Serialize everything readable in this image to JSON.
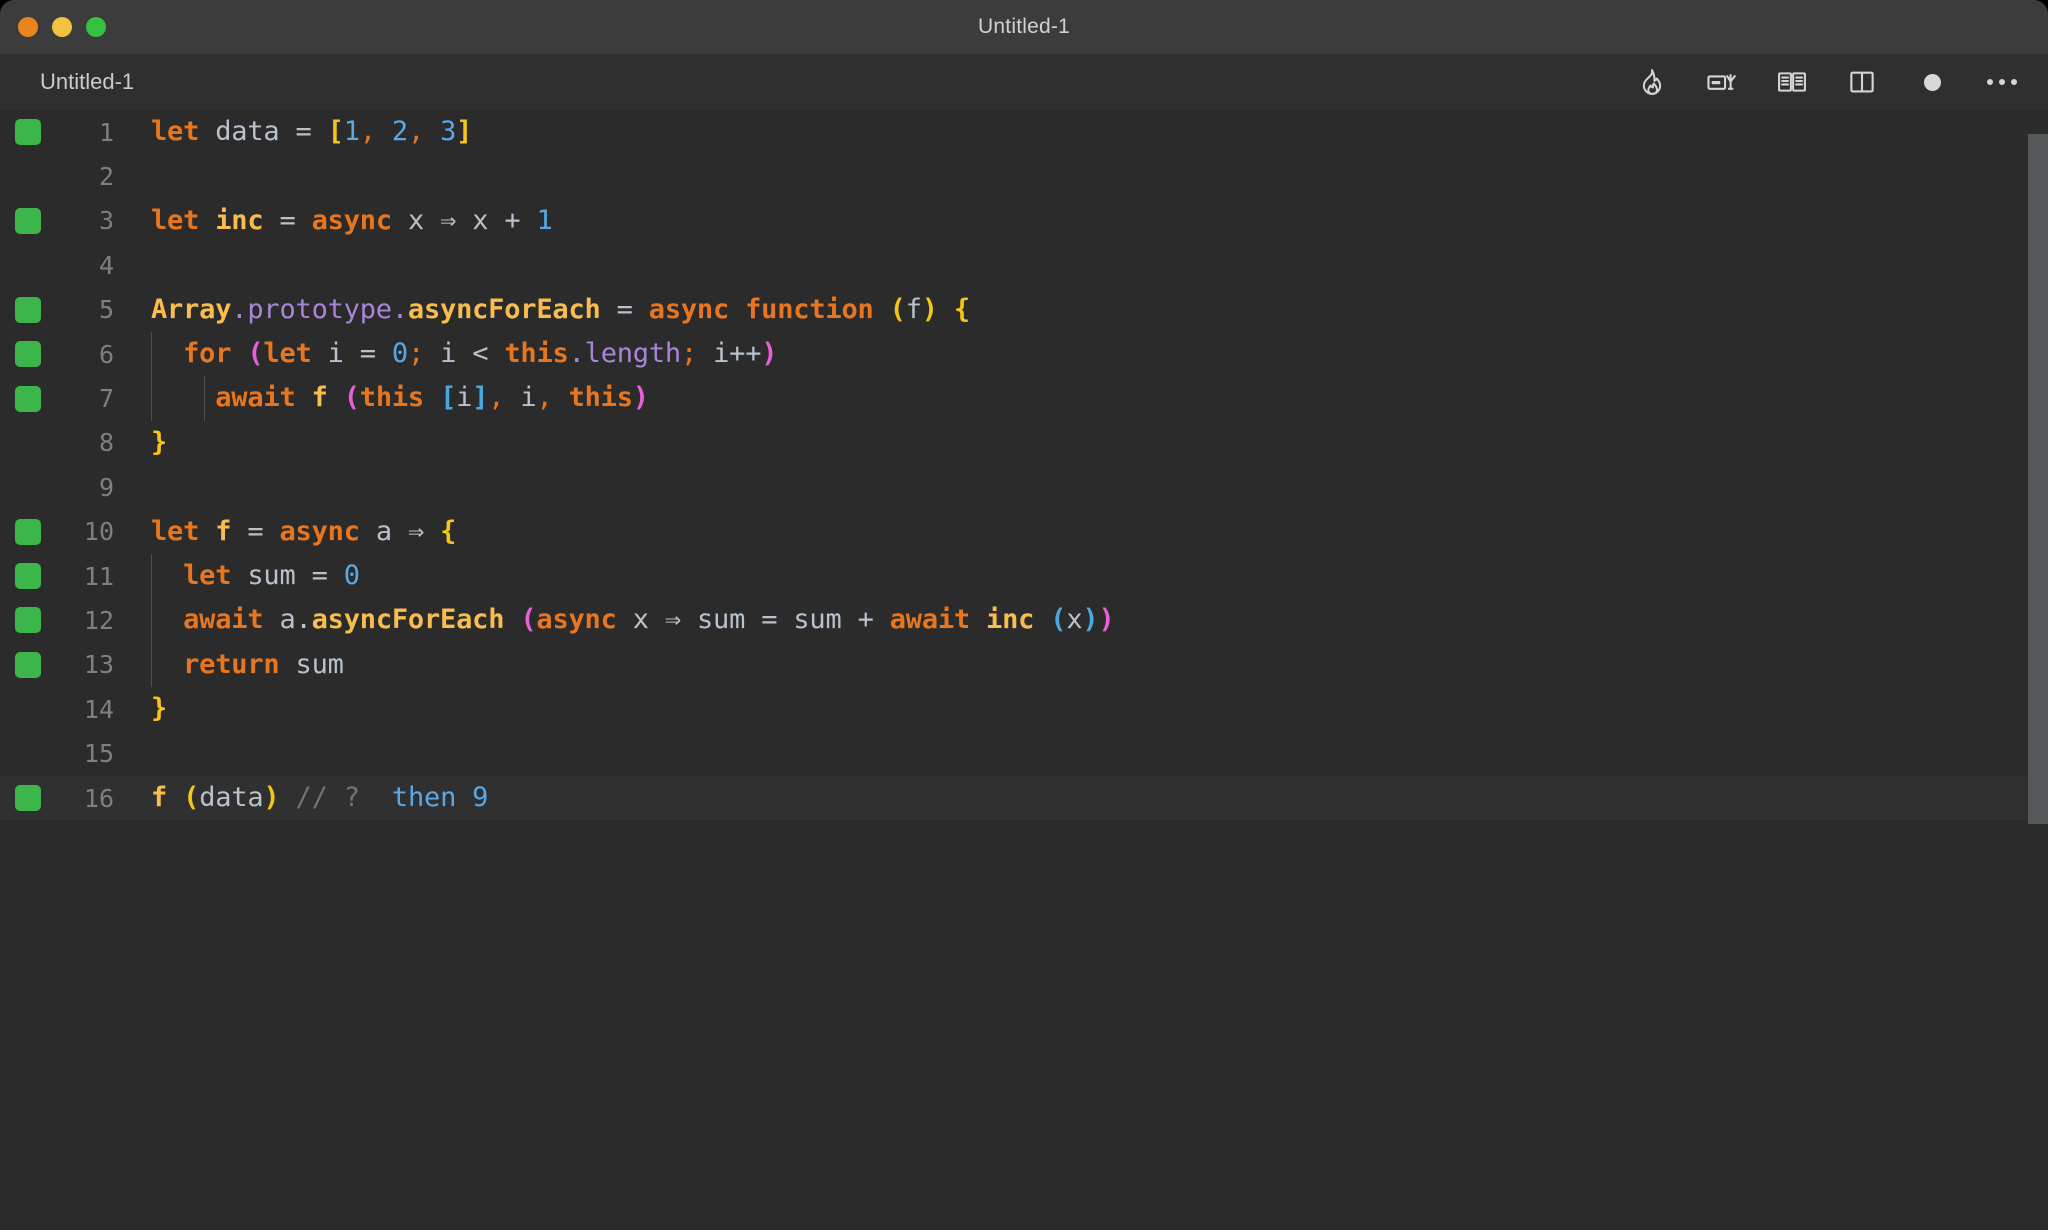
{
  "window": {
    "title": "Untitled-1",
    "traffic_lights": [
      "close",
      "minimize",
      "maximize"
    ]
  },
  "tabbar": {
    "tab_label": "Untitled-1",
    "toolbar_icons": [
      "flame-icon",
      "run-in-terminal-icon",
      "open-book-icon",
      "split-editor-icon",
      "unsaved-dot-icon",
      "more-actions-ellipsis-icon"
    ]
  },
  "colors": {
    "titlebar_bg": "#3c3c3c",
    "tabbar_bg": "#2f2f2f",
    "editor_bg": "#2b2b2b",
    "active_line_bg": "#303030",
    "breakpoint_green": "#3cb54a",
    "keyword_orange": "#e8761f",
    "function_gold": "#f9bd4e",
    "number_blue": "#5aa9e6",
    "plain_text": "#b9c2cc",
    "bracket_yellow": "#f5c518",
    "bracket_cyan": "#4aa8e0",
    "bracket_magenta": "#e861d8",
    "property_purple": "#a885d8",
    "comment_gray": "#6f7478",
    "line_number_gray": "#7c8084"
  },
  "editor": {
    "lines": [
      {
        "n": "1",
        "marker": true,
        "active": false,
        "guides": 0
      },
      {
        "n": "2",
        "marker": false,
        "active": false,
        "guides": 0
      },
      {
        "n": "3",
        "marker": true,
        "active": false,
        "guides": 0
      },
      {
        "n": "4",
        "marker": false,
        "active": false,
        "guides": 0
      },
      {
        "n": "5",
        "marker": true,
        "active": false,
        "guides": 0
      },
      {
        "n": "6",
        "marker": true,
        "active": false,
        "guides": 1
      },
      {
        "n": "7",
        "marker": true,
        "active": false,
        "guides": 2
      },
      {
        "n": "8",
        "marker": false,
        "active": false,
        "guides": 0
      },
      {
        "n": "9",
        "marker": false,
        "active": false,
        "guides": 0
      },
      {
        "n": "10",
        "marker": true,
        "active": false,
        "guides": 0
      },
      {
        "n": "11",
        "marker": true,
        "active": false,
        "guides": 1
      },
      {
        "n": "12",
        "marker": true,
        "active": false,
        "guides": 1
      },
      {
        "n": "13",
        "marker": true,
        "active": false,
        "guides": 1
      },
      {
        "n": "14",
        "marker": false,
        "active": false,
        "guides": 0
      },
      {
        "n": "15",
        "marker": false,
        "active": false,
        "guides": 0
      },
      {
        "n": "16",
        "marker": true,
        "active": true,
        "guides": 0
      }
    ],
    "code_text": {
      "l1": "let data = [1, 2, 3]",
      "l2": "",
      "l3": "let inc = async x ⇒ x + 1",
      "l4": "",
      "l5": "Array.prototype.asyncForEach = async function (f) {",
      "l6": "  for (let i = 0; i < this.length; i++)",
      "l7": "    await f (this [i], i, this)",
      "l8": "}",
      "l9": "",
      "l10": "let f = async a ⇒ {",
      "l11": "  let sum = 0",
      "l12": "  await a.asyncForEach (async x ⇒ sum = sum + await inc (x))",
      "l13": "  return sum",
      "l14": "}",
      "l15": "",
      "l16": "f (data) // ?  then 9"
    },
    "tokens": {
      "let": "let",
      "data": "data",
      "eq": "=",
      "lbracket": "[",
      "rbracket": "]",
      "one": "1",
      "two": "2",
      "three": "3",
      "comma": ",",
      "inc": "inc",
      "async": "async",
      "x": "x",
      "arrow": "⇒",
      "plus": "+",
      "Array": "Array",
      "dot": ".",
      "prototype": "prototype",
      "asyncForEach": "asyncForEach",
      "function": "function",
      "f": "f",
      "lparen": "(",
      "rparen": ")",
      "lbrace": "{",
      "rbrace": "}",
      "for": "for",
      "i": "i",
      "zero": "0",
      "semi": ";",
      "lt": "<",
      "this": "this",
      "length": "length",
      "ipp": "i++",
      "await": "await",
      "a": "a",
      "sum": "sum",
      "return": "return",
      "comment": "// ?",
      "then": "then 9"
    }
  }
}
